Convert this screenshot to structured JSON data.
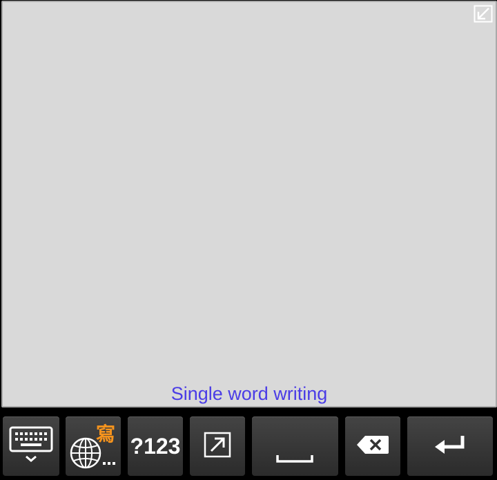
{
  "writing_pad": {
    "mode_label": "Single word writing",
    "mode_label_color": "#4a3ce6",
    "background": "#d9d9d9",
    "minimize_icon": "collapse-arrow-icon"
  },
  "keys": {
    "keyboard": {
      "icon": "keyboard-hide-icon"
    },
    "language": {
      "icon": "globe-icon",
      "badge": "寫",
      "badge_color": "#f7941d"
    },
    "symbols": {
      "label": "?123"
    },
    "expand": {
      "icon": "expand-arrow-icon"
    },
    "space": {
      "icon": "space-bar-icon"
    },
    "backspace": {
      "icon": "backspace-icon"
    },
    "enter": {
      "icon": "enter-icon"
    }
  }
}
